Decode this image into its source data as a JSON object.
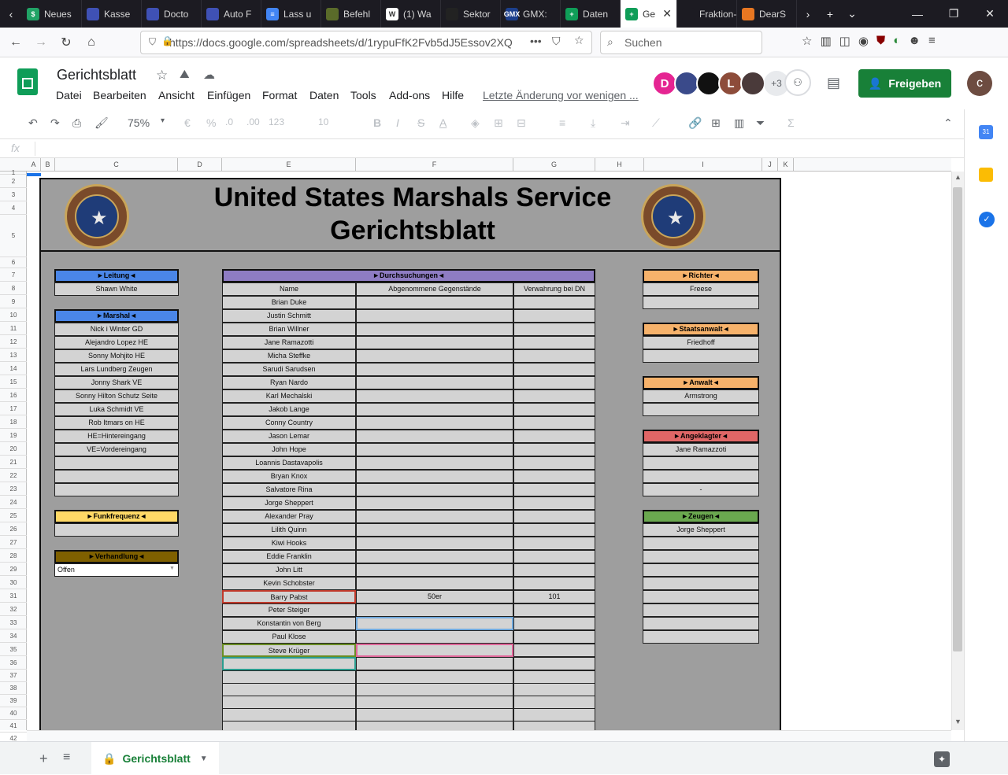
{
  "browser": {
    "tabs": [
      {
        "label": "Neues",
        "color": "#21a366",
        "icon": "$"
      },
      {
        "label": "Kasse",
        "color": "#3f51b5",
        "icon": ""
      },
      {
        "label": "Docto",
        "color": "#3f51b5",
        "icon": ""
      },
      {
        "label": "Auto F",
        "color": "#3f51b5",
        "icon": ""
      },
      {
        "label": "Lass u",
        "color": "#4285f4",
        "icon": "≡"
      },
      {
        "label": "Befehl",
        "color": "#5a6b2a",
        "icon": ""
      },
      {
        "label": "(1) Wa",
        "color": "#ffffff",
        "icon": "W"
      },
      {
        "label": "Sektor",
        "color": "#222",
        "icon": ""
      },
      {
        "label": "GMX:",
        "color": "#1c3f8c",
        "icon": "GMX"
      },
      {
        "label": "Daten",
        "color": "#0f9d58",
        "icon": "+"
      },
      {
        "label": "Ge",
        "color": "#0f9d58",
        "icon": "+"
      },
      {
        "label": "Fraktion-S",
        "color": "#1c1b22",
        "icon": ""
      },
      {
        "label": "DearS",
        "color": "#e87722",
        "icon": ""
      }
    ],
    "url": "https://docs.google.com/spreadsheets/d/1rypuFfK2Fvb5dJ5Essov2XQ",
    "search_placeholder": "Suchen"
  },
  "doc": {
    "title": "Gerichtsblatt",
    "menus": [
      "Datei",
      "Bearbeiten",
      "Ansicht",
      "Einfügen",
      "Format",
      "Daten",
      "Tools",
      "Add-ons",
      "Hilfe"
    ],
    "last_edit": "Letzte Änderung vor wenigen ...",
    "avatars": [
      {
        "letter": "D",
        "color": "#e52592"
      },
      {
        "letter": "",
        "color": "#3a4a8a"
      },
      {
        "letter": "",
        "color": "#111111"
      },
      {
        "letter": "L",
        "color": "#8d4c3a"
      },
      {
        "letter": "",
        "color": "#4a3a3a"
      }
    ],
    "more_count": "+3",
    "share_label": "Freigeben",
    "user_initial": "c"
  },
  "toolbar": {
    "zoom": "75%",
    "currency": "€",
    "percent": "%",
    "dec_less": ".0",
    "dec_more": ".00",
    "number_format": "123",
    "font_size": "10"
  },
  "formula": {
    "fx": "fx",
    "value": ""
  },
  "columns": [
    "A",
    "B",
    "C",
    "D",
    "E",
    "F",
    "G",
    "H",
    "I",
    "J",
    "K"
  ],
  "rows": [
    "1",
    "2",
    "3",
    "4",
    "5",
    "6",
    "7",
    "8",
    "9",
    "10",
    "11",
    "12",
    "13",
    "14",
    "15",
    "16",
    "17",
    "18",
    "19",
    "20",
    "21",
    "22",
    "23",
    "24",
    "25",
    "26",
    "27",
    "28",
    "29",
    "30",
    "31",
    "32",
    "33",
    "34",
    "35",
    "36",
    "37",
    "38",
    "39",
    "40",
    "41",
    "42"
  ],
  "sheet": {
    "title_line1": "United States Marshals Service",
    "title_line2": "Gerichtsblatt",
    "leitung": {
      "header": "►Leitung◄",
      "items": [
        "Shawn White"
      ]
    },
    "marshal": {
      "header": "►Marshal◄",
      "items": [
        "Nick i Winter GD",
        "Alejandro Lopez HE",
        "Sonny Mohjito HE",
        "Lars Lundberg Zeugen",
        "Jonny Shark VE",
        "Sonny Hilton Schutz Seite",
        "Luka Schmidt VE",
        "Rob Itmars on HE",
        "HE=Hintereingang",
        "VE=Vordereingang",
        "",
        "",
        ""
      ]
    },
    "funk": {
      "header": "►Funkfrequenz◄",
      "items": [
        ""
      ]
    },
    "verhandlung": {
      "header": "►Verhandlung◄",
      "value": "Offen"
    },
    "durchsuchungen": {
      "header": "►Durchsuchungen◄",
      "col_name": "Name",
      "col_items": "Abgenommene Gegenstände",
      "col_dn": "Verwahrung bei DN",
      "rows": [
        [
          "Brian Duke",
          "",
          ""
        ],
        [
          "Justin Schmitt",
          "",
          ""
        ],
        [
          "Brian Willner",
          "",
          ""
        ],
        [
          "Jane Ramazotti",
          "",
          ""
        ],
        [
          "Micha Steffke",
          "",
          ""
        ],
        [
          "Sarudi Sarudsen",
          "",
          ""
        ],
        [
          "Ryan Nardo",
          "",
          ""
        ],
        [
          "Karl Mechalski",
          "",
          ""
        ],
        [
          "Jakob Lange",
          "",
          ""
        ],
        [
          "Conny Country",
          "",
          ""
        ],
        [
          "Jason Lemar",
          "",
          ""
        ],
        [
          "John Hope",
          "",
          ""
        ],
        [
          "Loannis Dastavapolis",
          "",
          ""
        ],
        [
          "Bryan Knox",
          "",
          ""
        ],
        [
          "Salvatore Rina",
          "",
          ""
        ],
        [
          "Jorge Sheppert",
          "",
          ""
        ],
        [
          "Alexander Pray",
          "",
          ""
        ],
        [
          "Lilith Quinn",
          "",
          ""
        ],
        [
          "Kiwi Hooks",
          "",
          ""
        ],
        [
          "Eddie Franklin",
          "",
          ""
        ],
        [
          "John Litt",
          "",
          ""
        ],
        [
          "Kevin Schobster",
          "",
          ""
        ],
        [
          "Barry Pabst",
          "50er",
          "101"
        ],
        [
          "Peter Steiger",
          "",
          ""
        ],
        [
          "Konstantin von Berg",
          "",
          ""
        ],
        [
          "Paul Klose",
          "",
          ""
        ],
        [
          "Steve Krüger",
          "",
          ""
        ],
        [
          "",
          "",
          ""
        ],
        [
          "",
          "",
          ""
        ],
        [
          "",
          "",
          ""
        ],
        [
          "",
          "",
          ""
        ],
        [
          "",
          "",
          ""
        ],
        [
          "",
          "",
          ""
        ],
        [
          "",
          "",
          ""
        ],
        [
          "",
          "",
          ""
        ],
        [
          "",
          "",
          ""
        ]
      ]
    },
    "richter": {
      "header": "►Richter◄",
      "items": [
        "Freese",
        ""
      ]
    },
    "staatsanwalt": {
      "header": "►Staatsanwalt◄",
      "items": [
        "Friedhoff",
        ""
      ]
    },
    "anwalt": {
      "header": "►Anwalt◄",
      "items": [
        "Armstrong",
        ""
      ]
    },
    "angeklagter": {
      "header": "►Angeklagter◄",
      "items": [
        "Jane Ramazzoti",
        "",
        "",
        "-"
      ]
    },
    "zeugen": {
      "header": "►Zeugen◄",
      "items": [
        "Jorge Sheppert",
        "",
        "",
        "",
        "",
        "",
        "",
        "",
        ""
      ]
    }
  },
  "sheets": {
    "active": "Gerichtsblatt"
  },
  "colors": {
    "leitung": "#4a86e8",
    "marshal": "#4a86e8",
    "funk": "#ffd966",
    "verhandlung": "#7f6000",
    "durchsuchungen": "#8e7cc3",
    "richter": "#f6b26b",
    "staatsanwalt": "#f6b26b",
    "anwalt": "#f6b26b",
    "angeklagter": "#e06666",
    "zeugen": "#6aa84f",
    "share": "#188038"
  }
}
